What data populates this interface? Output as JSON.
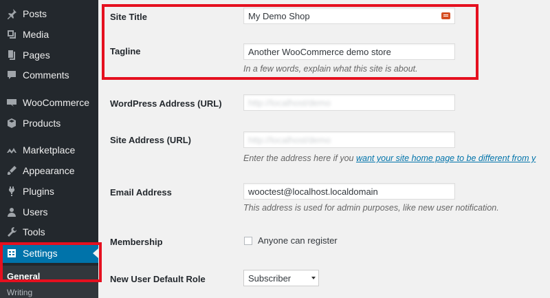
{
  "sidebar": {
    "items": [
      {
        "label": "Posts",
        "icon": "pin-icon"
      },
      {
        "label": "Media",
        "icon": "media-icon"
      },
      {
        "label": "Pages",
        "icon": "pages-icon"
      },
      {
        "label": "Comments",
        "icon": "comments-icon"
      },
      {
        "label": "WooCommerce",
        "icon": "woocommerce-icon"
      },
      {
        "label": "Products",
        "icon": "products-icon"
      },
      {
        "label": "Marketplace",
        "icon": "marketplace-icon"
      },
      {
        "label": "Appearance",
        "icon": "appearance-icon"
      },
      {
        "label": "Plugins",
        "icon": "plugins-icon"
      },
      {
        "label": "Users",
        "icon": "users-icon"
      },
      {
        "label": "Tools",
        "icon": "tools-icon"
      },
      {
        "label": "Settings",
        "icon": "settings-icon"
      }
    ],
    "submenu": {
      "current": "General",
      "next": "Writing"
    }
  },
  "form": {
    "site_title": {
      "label": "Site Title",
      "value": "My Demo Shop"
    },
    "tagline": {
      "label": "Tagline",
      "value": "Another WooCommerce demo store",
      "description": "In a few words, explain what this site is about."
    },
    "wp_address": {
      "label": "WordPress Address (URL)",
      "value": "http://localhost/demo"
    },
    "site_address": {
      "label": "Site Address (URL)",
      "value": "http://localhost/demo",
      "description_prefix": "Enter the address here if you ",
      "description_link": "want your site home page to be different from y"
    },
    "email": {
      "label": "Email Address",
      "value": "wooctest@localhost.localdomain",
      "description": "This address is used for admin purposes, like new user notification."
    },
    "membership": {
      "label": "Membership",
      "checkbox_label": "Anyone can register"
    },
    "default_role": {
      "label": "New User Default Role",
      "value": "Subscriber"
    }
  },
  "colors": {
    "sidebar_bg": "#23282d",
    "active_bg": "#0073aa",
    "highlight": "#e5101f",
    "link": "#0073aa"
  }
}
